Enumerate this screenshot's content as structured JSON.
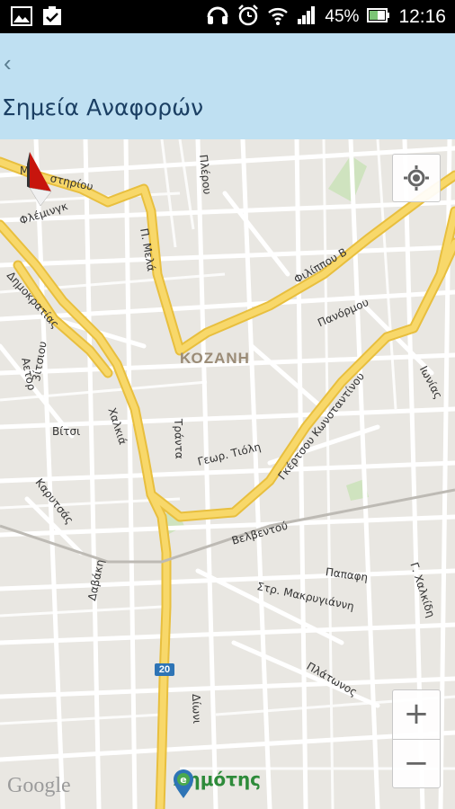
{
  "status_bar": {
    "battery": "45%",
    "time": "12:16",
    "left_icons": [
      "gallery-icon",
      "clipboard-icon"
    ],
    "right_icons": [
      "headset-icon",
      "alarm-icon",
      "wifi-icon",
      "signal-icon",
      "battery-icon"
    ]
  },
  "action_bar": {
    "back_glyph": "‹",
    "title": "Σημεία Αναφορών"
  },
  "map": {
    "city_label": "ΚΟΖΑΝΗ",
    "street_labels": [
      {
        "text": "Μ",
        "name": "street-label-m"
      },
      {
        "text": "στηρίου",
        "name": "street-label-stiriou"
      },
      {
        "text": "Φλέμινγκ",
        "name": "street-label-fleming"
      },
      {
        "text": "Δημοκρατίας",
        "name": "street-label-dimokratias"
      },
      {
        "text": "Αετορ",
        "name": "street-label-aetor"
      },
      {
        "text": "3ίτσιου",
        "name": "street-label-zitsiou"
      },
      {
        "text": "Π. Μελά",
        "name": "street-label-p-mela"
      },
      {
        "text": "Πλέρου",
        "name": "street-label-plerou"
      },
      {
        "text": "Φιλίππου Β",
        "name": "street-label-filippou"
      },
      {
        "text": "Πανόρμου",
        "name": "street-label-panormou"
      },
      {
        "text": "Ιωνίας",
        "name": "street-label-ionias"
      },
      {
        "text": "Χαλκιά",
        "name": "street-label-chalkia"
      },
      {
        "text": "Βίτσι",
        "name": "street-label-vitsi"
      },
      {
        "text": "Καρυτσάς",
        "name": "street-label-karytsas"
      },
      {
        "text": "Τράντα",
        "name": "street-label-tranta"
      },
      {
        "text": "Γεωρ. Τιόλη",
        "name": "street-label-georg-tioli"
      },
      {
        "text": "Γκέρτσου Κωνσταντίνου",
        "name": "street-label-gkertsou"
      },
      {
        "text": "Βελβεντού",
        "name": "street-label-velventou"
      },
      {
        "text": "Δαβάκη",
        "name": "street-label-davaki"
      },
      {
        "text": "Παπαφη",
        "name": "street-label-papafi"
      },
      {
        "text": "Στρ. Μακρυγιάννη",
        "name": "street-label-makrygianni"
      },
      {
        "text": "Γ. Χαλκίδη",
        "name": "street-label-chalkidi"
      },
      {
        "text": "Πλάτωνος",
        "name": "street-label-platonos"
      },
      {
        "text": "Δίωνι",
        "name": "street-label-dioni"
      }
    ],
    "road_shield": "20",
    "zoom_in": "+",
    "zoom_out": "−",
    "google_logo": "Google",
    "brand_text": "Δημότης"
  },
  "colors": {
    "status_bar": "#000000",
    "action_bar": "#bfe0f2",
    "title": "#1b3f63",
    "major_road": "#f7d35a",
    "minor_road": "#ffffff",
    "map_bg": "#e9e7e2",
    "brand_green": "#2e8b3a"
  }
}
